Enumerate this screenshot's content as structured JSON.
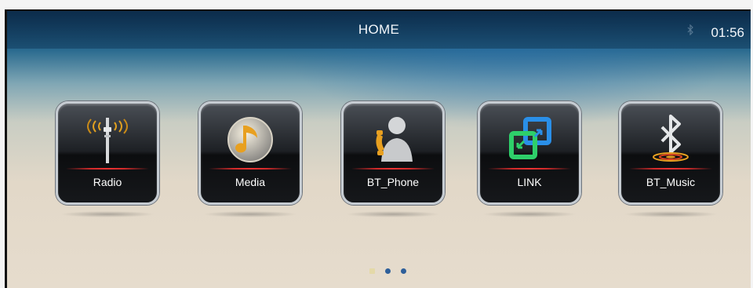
{
  "header": {
    "title": "HOME",
    "clock": "01:56"
  },
  "apps": [
    {
      "label": "Radio",
      "icon": "radio-tower-icon"
    },
    {
      "label": "Media",
      "icon": "music-note-icon"
    },
    {
      "label": "BT_Phone",
      "icon": "phone-contact-icon"
    },
    {
      "label": "LINK",
      "icon": "link-squares-icon"
    },
    {
      "label": "BT_Music",
      "icon": "bluetooth-icon"
    }
  ],
  "pager": {
    "count": 3,
    "active_index": 0
  },
  "colors": {
    "accent_red": "#d02a2a",
    "header_bg": "#1c4f77",
    "tile_border": "#c6ccd2",
    "link_green": "#2ecf6a",
    "link_blue": "#2a8fe8",
    "media_orange": "#e8a020"
  }
}
